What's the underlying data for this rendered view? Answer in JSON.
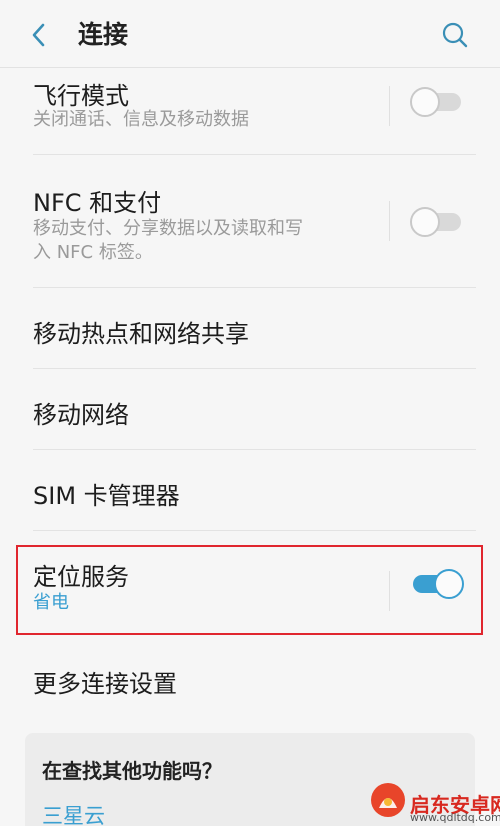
{
  "header": {
    "back_icon": "chevron-left-icon",
    "title": "连接",
    "search_icon": "search-icon"
  },
  "accent_color": "#3a9fd1",
  "settings": {
    "airplane": {
      "title": "飞行模式",
      "subtitle": "关闭通话、信息及移动数据",
      "toggle_on": false
    },
    "nfc": {
      "title": "NFC 和支付",
      "subtitle_line1": "移动支付、分享数据以及读取和写",
      "subtitle_line2": "入 NFC 标签。",
      "toggle_on": false
    },
    "hotspot": {
      "title": "移动热点和网络共享"
    },
    "mobile_network": {
      "title": "移动网络"
    },
    "sim": {
      "title": "SIM 卡管理器"
    },
    "location": {
      "title": "定位服务",
      "subtitle": "省电",
      "toggle_on": true
    },
    "more": {
      "title": "更多连接设置"
    }
  },
  "card": {
    "title": "在查找其他功能吗？",
    "link": "三星云"
  },
  "watermark": {
    "text": "启东安卓网",
    "url": "www.qdltdq.com"
  }
}
